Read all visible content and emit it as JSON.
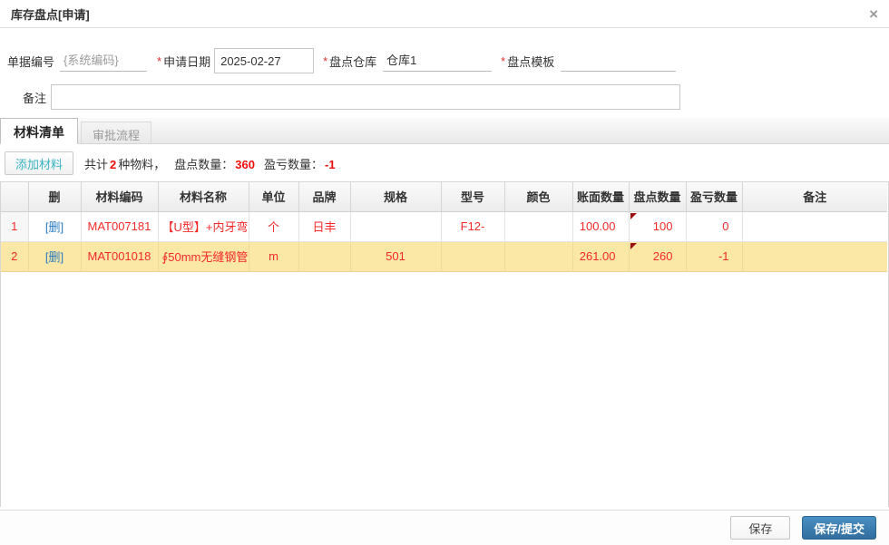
{
  "dialog": {
    "title": "库存盘点[申请]",
    "close_icon": "×"
  },
  "form": {
    "doc_no": {
      "label": "单据编号",
      "value": "{系统编码}"
    },
    "date": {
      "label": "申请日期",
      "required_marker": "*",
      "value": "2025-02-27"
    },
    "warehouse": {
      "label": "盘点仓库",
      "required_marker": "*",
      "value": "仓库1"
    },
    "template": {
      "label": "盘点模板",
      "required_marker": "*",
      "value": ""
    },
    "remark": {
      "label": "备注",
      "value": ""
    }
  },
  "tabs": [
    {
      "label": "材料清单",
      "active": true
    },
    {
      "label": "审批流程",
      "active": false
    }
  ],
  "toolbar": {
    "add_button": "添加材料",
    "summary": {
      "prefix": "共计",
      "count": "2",
      "mid1": "种物料，",
      "label_total": "盘点数量：",
      "total": "360",
      "label_diff": "盈亏数量：",
      "diff": "-1"
    }
  },
  "table": {
    "columns": [
      "",
      "删",
      "材料编码",
      "材料名称",
      "单位",
      "品牌",
      "规格",
      "型号",
      "颜色",
      "账面数量",
      "盘点数量",
      "盈亏数量",
      "备注"
    ],
    "rows": [
      {
        "index": "1",
        "delete": "[删]",
        "code": "MAT007181",
        "name": "【U型】+内牙弯",
        "unit": "个",
        "brand": "日丰",
        "spec": "",
        "model": "F12-",
        "color": "",
        "book_qty": "100.00",
        "count_qty": "100",
        "diff_qty": "0",
        "remark": ""
      },
      {
        "index": "2",
        "delete": "[删]",
        "code": "MAT001018",
        "name": "∮50mm无缝钢管",
        "unit": "m",
        "brand": "",
        "spec": "501",
        "model": "",
        "color": "",
        "book_qty": "261.00",
        "count_qty": "260",
        "diff_qty": "-1",
        "remark": ""
      }
    ]
  },
  "footer": {
    "save_label": "保存",
    "submit_label": "保存/提交"
  },
  "colors": {
    "highlight_row": "#fbe7a6",
    "red_text": "#f42a2a",
    "summary_red": "#f00f0f",
    "link_blue": "#2d7dc1",
    "accent_teal": "#3ab3c3",
    "submit_blue": "#306e9e",
    "flag_maroon": "#9b1111"
  }
}
